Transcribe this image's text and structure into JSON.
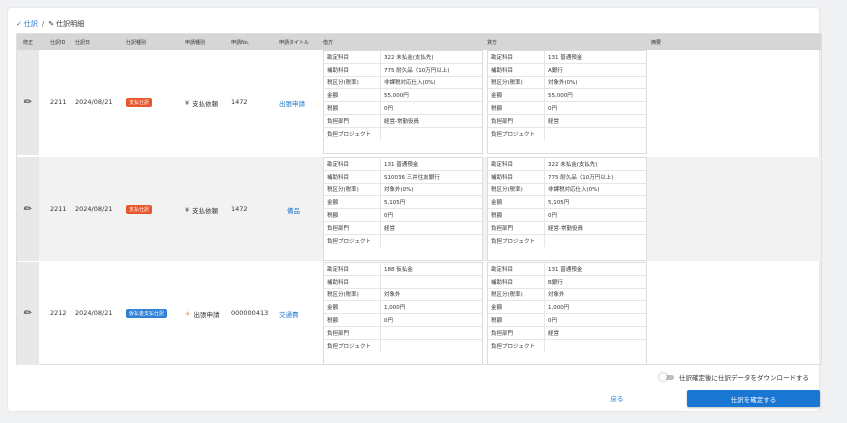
{
  "breadcrumb": {
    "root_label": "仕訳",
    "current_label": "仕訳明細"
  },
  "table": {
    "headers": {
      "edit": "修正",
      "id": "仕訳ID",
      "date": "仕訳日",
      "type": "仕訳種別",
      "application_type": "申請種別",
      "application_no": "申請No.",
      "application_title": "申請タイトル",
      "debit": "借方",
      "credit": "貸方",
      "summary": "摘要"
    },
    "rows": [
      {
        "id": "2211",
        "date": "2024/08/21",
        "type_badge": "支払仕訳",
        "type_color": "#e8572a",
        "app_icon": "yen-icon",
        "app_icon_glyph": "¥",
        "application_type": "支払依頼",
        "application_no": "1472",
        "application_title": "出張申請",
        "debit": [
          {
            "k": "勘定科目",
            "v": "322 未払金(支払先)"
          },
          {
            "k": "補助科目",
            "v": "775 耐久品（10万円以上)"
          },
          {
            "k": "税区分(税率)",
            "v": "非課税対応仕入(0%)"
          },
          {
            "k": "金額",
            "v": "55,000円"
          },
          {
            "k": "税額",
            "v": "0円"
          },
          {
            "k": "負担部門",
            "v": "経営-常勤役員"
          },
          {
            "k": "負担プロジェクト",
            "v": ""
          }
        ],
        "credit": [
          {
            "k": "勘定科目",
            "v": "131 普通預金"
          },
          {
            "k": "補助科目",
            "v": "A銀行"
          },
          {
            "k": "税区分(税率)",
            "v": "対象外(0%)"
          },
          {
            "k": "金額",
            "v": "55,000円"
          },
          {
            "k": "税額",
            "v": "0円"
          },
          {
            "k": "負担部門",
            "v": "経営"
          },
          {
            "k": "負担プロジェクト",
            "v": ""
          }
        ]
      },
      {
        "id": "2211",
        "date": "2024/08/21",
        "type_badge": "支払仕訳",
        "type_color": "#e8572a",
        "app_icon": "yen-icon",
        "app_icon_glyph": "¥",
        "application_type": "支払依頼",
        "application_no": "1472",
        "application_title": "備品",
        "debit": [
          {
            "k": "勘定科目",
            "v": "131 普通預金"
          },
          {
            "k": "補助科目",
            "v": "S10036 三井住友銀行"
          },
          {
            "k": "税区分(税率)",
            "v": "対象外(0%)"
          },
          {
            "k": "金額",
            "v": "5,105円"
          },
          {
            "k": "税額",
            "v": "0円"
          },
          {
            "k": "負担部門",
            "v": "経営"
          },
          {
            "k": "負担プロジェクト",
            "v": ""
          }
        ],
        "credit": [
          {
            "k": "勘定科目",
            "v": "322 未払金(支払先)"
          },
          {
            "k": "補助科目",
            "v": "775 耐久品（10万円以上)"
          },
          {
            "k": "税区分(税率)",
            "v": "非課税対応仕入(0%)"
          },
          {
            "k": "金額",
            "v": "5,105円"
          },
          {
            "k": "税額",
            "v": "0円"
          },
          {
            "k": "負担部門",
            "v": "経営-常勤役員"
          },
          {
            "k": "負担プロジェクト",
            "v": ""
          }
        ]
      },
      {
        "id": "2212",
        "date": "2024/08/21",
        "type_badge": "仮払金支払仕訳",
        "type_color": "#2f7fd6",
        "app_icon": "airplane-icon",
        "app_icon_glyph": "✈",
        "application_type": "出張申請",
        "application_no": "000000413",
        "application_title": "交通費",
        "debit": [
          {
            "k": "勘定科目",
            "v": "188 仮払金"
          },
          {
            "k": "補助科目",
            "v": ""
          },
          {
            "k": "税区分(税率)",
            "v": "対象外"
          },
          {
            "k": "金額",
            "v": "1,000円"
          },
          {
            "k": "税額",
            "v": "0円"
          },
          {
            "k": "負担部門",
            "v": ""
          },
          {
            "k": "負担プロジェクト",
            "v": ""
          }
        ],
        "credit": [
          {
            "k": "勘定科目",
            "v": "131 普通預金"
          },
          {
            "k": "補助科目",
            "v": "B銀行"
          },
          {
            "k": "税区分(税率)",
            "v": "対象外"
          },
          {
            "k": "金額",
            "v": "1,000円"
          },
          {
            "k": "税額",
            "v": "0円"
          },
          {
            "k": "負担部門",
            "v": "経営"
          },
          {
            "k": "負担プロジェクト",
            "v": ""
          }
        ]
      }
    ]
  },
  "footer": {
    "toggle_label": "仕訳確定後に仕訳データをダウンロードする",
    "back_label": "戻る",
    "confirm_label": "仕訳を確定する"
  },
  "colors": {
    "accent": "#1976d2",
    "badge_payment": "#e8572a",
    "badge_advance": "#2f7fd6"
  }
}
